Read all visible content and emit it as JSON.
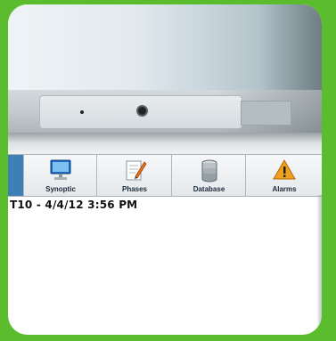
{
  "toolbar": {
    "buttons": [
      {
        "label": "Synoptic",
        "icon": "monitor-icon"
      },
      {
        "label": "Phases",
        "icon": "clipboard-edit-icon"
      },
      {
        "label": "Database",
        "icon": "database-icon"
      },
      {
        "label": "Alarms",
        "icon": "warning-icon"
      }
    ]
  },
  "status": {
    "text": "T10 - 4/4/12 3:56 PM"
  },
  "colors": {
    "frame": "#5bbd2e",
    "toolbar_accent": "#3f7fb8",
    "alarm": "#f0a020"
  }
}
